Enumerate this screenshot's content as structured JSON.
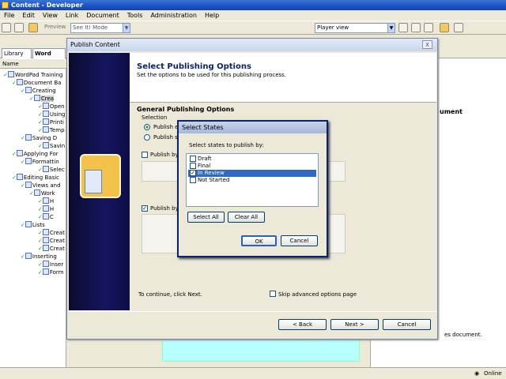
{
  "app": {
    "title": "Content - Developer"
  },
  "menu": [
    "File",
    "Edit",
    "View",
    "Link",
    "Document",
    "Tools",
    "Administration",
    "Help"
  ],
  "toolbar": {
    "preview_label": "Preview",
    "mode_value": "See It! Mode",
    "player_value": "Player view"
  },
  "left_pane": {
    "tabs": [
      "Library",
      "Word"
    ],
    "column_header": "Name",
    "tree": [
      "WordPad Training",
      "Document Ba",
      "Creating",
      "Crea",
      "Open",
      "Using",
      "Printi",
      "Temp",
      "Saving D",
      "Savin",
      "Applying For",
      "Formattin",
      "Selec",
      "Editing Basic",
      "Views and",
      "Work",
      "H",
      "H",
      "C",
      "Lists",
      "Creat",
      "Creat",
      "Creat",
      "Inserting",
      "Inser",
      "Form"
    ]
  },
  "right_pane": {
    "heading": "ument",
    "note": "es document."
  },
  "status": {
    "text": "Online"
  },
  "publish_dialog": {
    "title": "Publish Content",
    "close": "X",
    "heading": "Select Publishing Options",
    "subheading": "Set the options to be used for this publishing process.",
    "section": "General Publishing Options",
    "selection_label": "Selection",
    "radio1": "Publish en",
    "radio2": "Publish se",
    "chk1": "Publish by n",
    "chk2": "Publish by s",
    "footer_hint": "To continue, click Next.",
    "skip_label": "Skip advanced options page",
    "back": "< Back",
    "next": "Next >",
    "cancel": "Cancel"
  },
  "states_dialog": {
    "title": "Select States",
    "prompt": "Select states to publish by:",
    "items": [
      {
        "label": "Draft",
        "checked": false
      },
      {
        "label": "Final",
        "checked": false
      },
      {
        "label": "In Review",
        "checked": true
      },
      {
        "label": "Not Started",
        "checked": false
      }
    ],
    "select_all": "Select All",
    "clear_all": "Clear All",
    "ok": "OK",
    "cancel": "Cancel"
  }
}
